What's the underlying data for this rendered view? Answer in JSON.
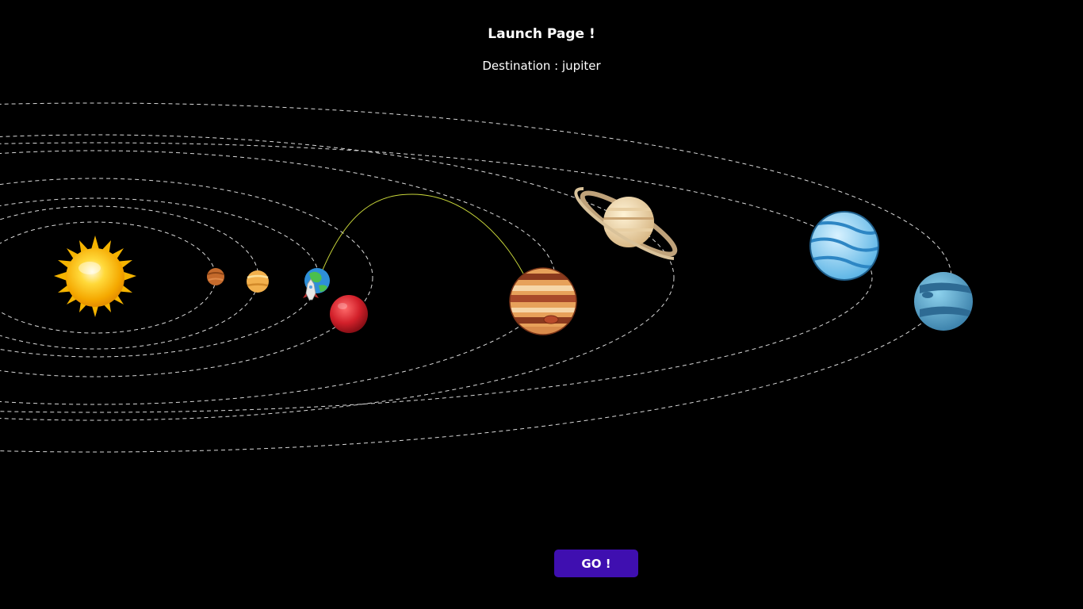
{
  "header": {
    "title": "Launch Page !",
    "subtitle": "Destination : jupiter"
  },
  "solar_system": {
    "bodies": [
      {
        "name": "sun",
        "icon": "sun-icon"
      },
      {
        "name": "mercury",
        "icon": "mercury-icon"
      },
      {
        "name": "venus",
        "icon": "venus-icon"
      },
      {
        "name": "earth",
        "icon": "earth-icon"
      },
      {
        "name": "mars",
        "icon": "mars-icon"
      },
      {
        "name": "jupiter",
        "icon": "jupiter-icon"
      },
      {
        "name": "saturn",
        "icon": "saturn-icon"
      },
      {
        "name": "uranus",
        "icon": "uranus-icon"
      },
      {
        "name": "neptune",
        "icon": "neptune-icon"
      }
    ],
    "rocket_icon": "rocket-icon",
    "trajectory_color": "#c8d63a",
    "orbit_color": "#ffffff"
  },
  "actions": {
    "go_label": "GO !"
  },
  "colors": {
    "background": "#000000",
    "button": "#3f0fb0",
    "text": "#ffffff"
  }
}
